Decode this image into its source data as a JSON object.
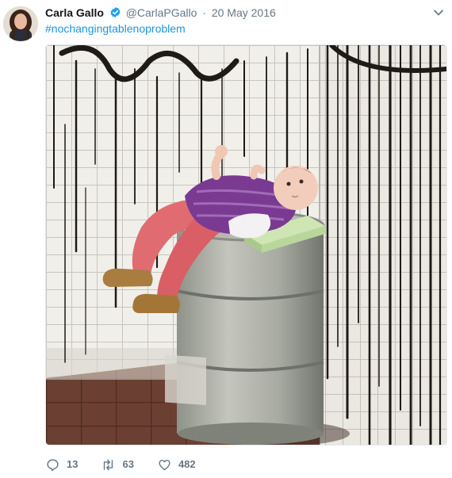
{
  "tweet": {
    "author_name": "Carla Gallo",
    "author_handle": "@CarlaPGallo",
    "separator": "·",
    "date": "20 May 2016",
    "text": "#nochangingtablenoproblem",
    "media_description": "photo",
    "counts": {
      "replies": "13",
      "retweets": "63",
      "likes": "482"
    }
  },
  "icons": {
    "verified": "verified-badge-icon",
    "menu": "chevron-down-icon",
    "reply": "reply-icon",
    "retweet": "retweet-icon",
    "like": "heart-icon"
  },
  "colors": {
    "link": "#1b95e0",
    "verified": "#1da1f2",
    "muted": "#657786",
    "text": "#14171a"
  }
}
